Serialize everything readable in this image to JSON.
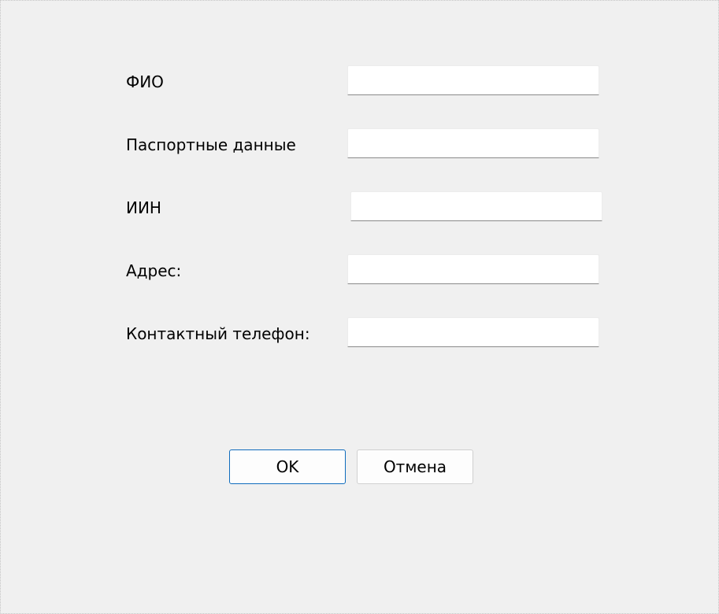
{
  "form": {
    "fields": [
      {
        "label": "ФИО",
        "value": ""
      },
      {
        "label": "Паспортные данные",
        "value": ""
      },
      {
        "label": "ИИН",
        "value": ""
      },
      {
        "label": "Адрес:",
        "value": ""
      },
      {
        "label": "Контактный телефон:",
        "value": ""
      }
    ]
  },
  "buttons": {
    "ok_label": "OK",
    "cancel_label": "Отмена"
  },
  "colors": {
    "background": "#f0f0f0",
    "field_background": "#ffffff",
    "accent_border": "#0f6cbd"
  }
}
